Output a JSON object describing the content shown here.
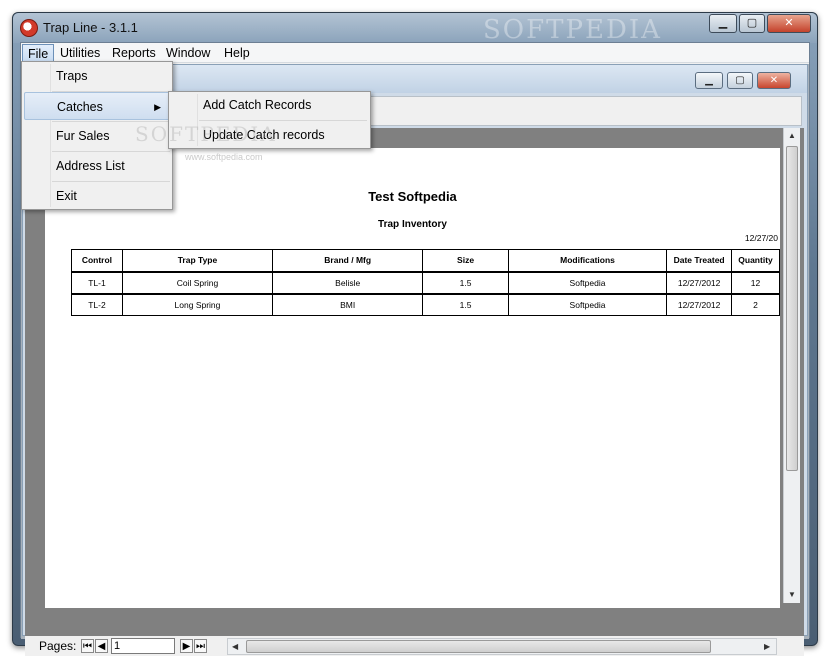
{
  "window": {
    "title": "Trap Line  -  3.1.1",
    "watermark": "SOFTPEDIA",
    "minimize": "▁",
    "maximize": "▢",
    "close": "✕"
  },
  "menubar": {
    "items": [
      {
        "label": "File"
      },
      {
        "label": "Utilities"
      },
      {
        "label": "Reports"
      },
      {
        "label": "Window"
      },
      {
        "label": "Help"
      }
    ]
  },
  "file_menu": {
    "items": [
      {
        "label": "Traps"
      },
      {
        "label": "Catches"
      },
      {
        "label": "Fur Sales"
      },
      {
        "label": "Address List"
      },
      {
        "label": "Exit"
      }
    ],
    "submenu_arrow": "▶"
  },
  "catches_submenu": {
    "items": [
      {
        "label": "Add Catch Records"
      },
      {
        "label": "Update Catch records"
      }
    ]
  },
  "watermark": {
    "text": "SOFTPEDIA",
    "url": "www.softpedia.com"
  },
  "report": {
    "title": "Test Softpedia",
    "subtitle": "Trap Inventory",
    "date": "12/27/20",
    "columns": [
      "Control",
      "Trap Type",
      "Brand / Mfg",
      "Size",
      "Modifications",
      "Date Treated",
      "Quantity"
    ],
    "rows": [
      [
        "TL-1",
        "Coil Spring",
        "Belisle",
        "1.5",
        "Softpedia",
        "12/27/2012",
        "12"
      ],
      [
        "TL-2",
        "Long Spring",
        "BMI",
        "1.5",
        "Softpedia",
        "12/27/2012",
        "2"
      ]
    ]
  },
  "pager": {
    "label": "Pages:",
    "current_page": "1"
  },
  "colors": {
    "menu_highlight": "#cfdef0",
    "viewer_bg": "#808080",
    "close_button": "#c4422b"
  }
}
